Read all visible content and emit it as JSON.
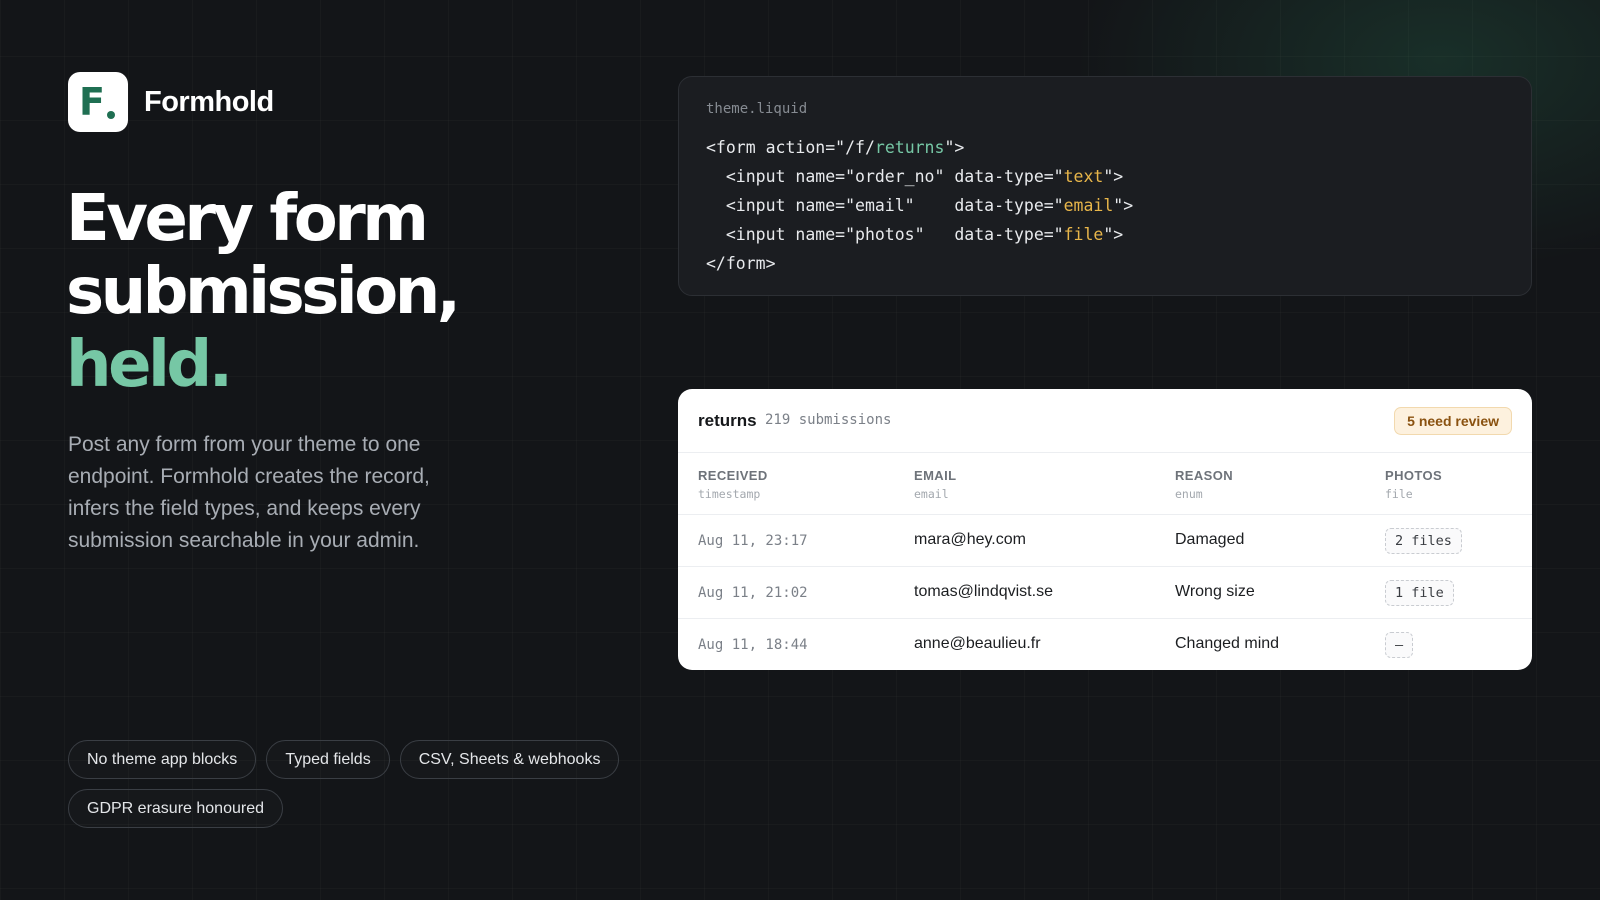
{
  "brand": {
    "logo_letter": "F",
    "name": "Formhold"
  },
  "hero": {
    "headline_line1": "Every form",
    "headline_line2": "submission,",
    "headline_accent": "held.",
    "lede": "Post any form from your theme to one endpoint. Formhold creates the record, infers the field types, and keeps every submission searchable in your admin."
  },
  "features": [
    "No theme app blocks",
    "Typed fields",
    "CSV, Sheets & webhooks",
    "GDPR erasure honoured"
  ],
  "code": {
    "filename": "theme.liquid",
    "lines": [
      [
        {
          "t": "<form action=\"/f/"
        },
        {
          "t": "returns",
          "c": "path"
        },
        {
          "t": "\">"
        }
      ],
      [
        {
          "t": "  <input name=\"order_no\" data-type=\""
        },
        {
          "t": "text",
          "c": "type"
        },
        {
          "t": "\">"
        }
      ],
      [
        {
          "t": "  <input name=\"email\"    data-type=\""
        },
        {
          "t": "email",
          "c": "type"
        },
        {
          "t": "\">"
        }
      ],
      [
        {
          "t": "  <input name=\"photos\"   data-type=\""
        },
        {
          "t": "file",
          "c": "type"
        },
        {
          "t": "\">"
        }
      ],
      [
        {
          "t": "</form>"
        }
      ]
    ]
  },
  "table": {
    "name": "returns",
    "count": "219 submissions",
    "badge": "5 need review",
    "columns": [
      {
        "title": "RECEIVED",
        "type": "timestamp"
      },
      {
        "title": "EMAIL",
        "type": "email"
      },
      {
        "title": "REASON",
        "type": "enum"
      },
      {
        "title": "PHOTOS",
        "type": "file"
      }
    ],
    "rows": [
      {
        "received": "Aug 11, 23:17",
        "email": "mara@hey.com",
        "reason": "Damaged",
        "photos": "2 files"
      },
      {
        "received": "Aug 11, 21:02",
        "email": "tomas@lindqvist.se",
        "reason": "Wrong size",
        "photos": "1 file"
      },
      {
        "received": "Aug 11, 18:44",
        "email": "anne@beaulieu.fr",
        "reason": "Changed mind",
        "photos": "–"
      }
    ]
  },
  "colors": {
    "accent": "#76c7a5",
    "background": "#131518",
    "logo_green": "#1f6f52",
    "code_type": "#e8b64a",
    "badge_text": "#8a5210"
  }
}
